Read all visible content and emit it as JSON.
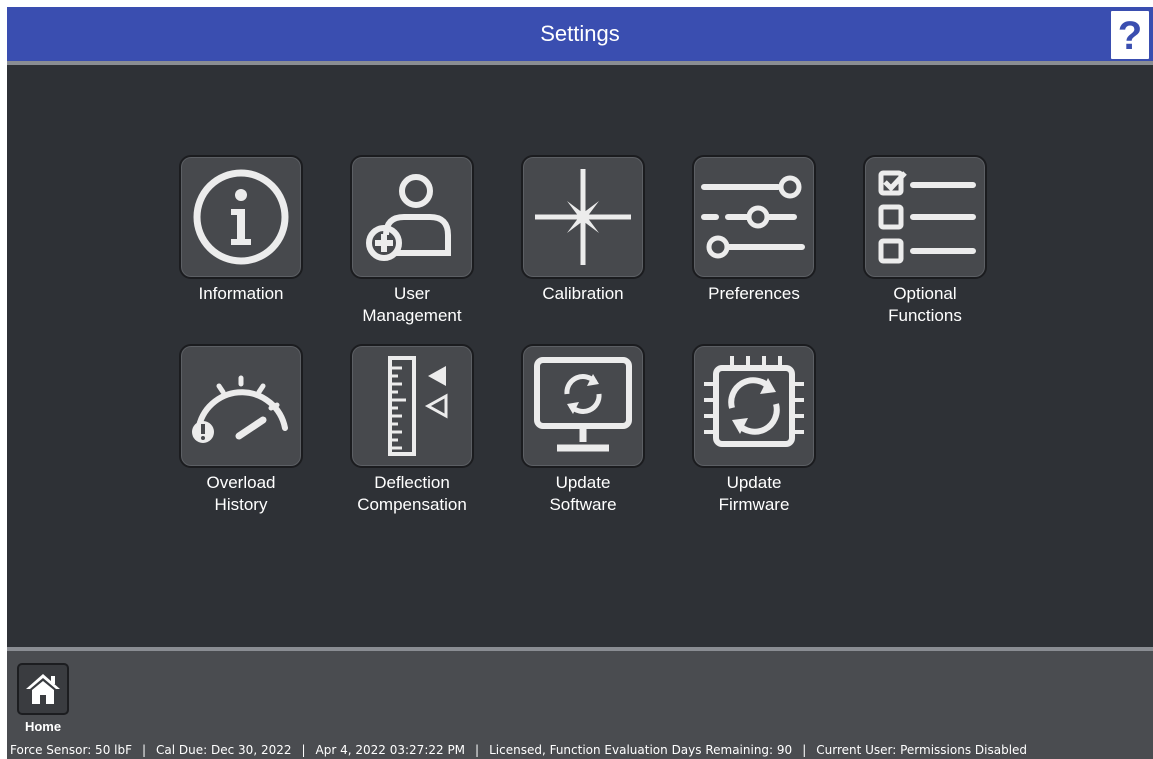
{
  "header": {
    "title": "Settings",
    "help_label": "?"
  },
  "tiles": [
    {
      "label": "Information",
      "icon": "info-icon"
    },
    {
      "label": "User\nManagement",
      "icon": "user-add-icon"
    },
    {
      "label": "Calibration",
      "icon": "crosshair-icon"
    },
    {
      "label": "Preferences",
      "icon": "sliders-icon"
    },
    {
      "label": "Optional\nFunctions",
      "icon": "checklist-icon"
    },
    {
      "label": "Overload\nHistory",
      "icon": "gauge-warning-icon"
    },
    {
      "label": "Deflection\nCompensation",
      "icon": "ruler-arrows-icon"
    },
    {
      "label": "Update\nSoftware",
      "icon": "monitor-refresh-icon"
    },
    {
      "label": "Update\nFirmware",
      "icon": "chip-refresh-icon"
    }
  ],
  "footer": {
    "home_label": "Home"
  },
  "status": {
    "force_sensor": "Force Sensor: 50 lbF",
    "cal_due": "Cal Due: Dec 30, 2022",
    "datetime": "Apr 4, 2022 03:27:22 PM",
    "license": "Licensed, Function Evaluation Days Remaining: 90",
    "current_user": "Current User: Permissions Disabled",
    "separator": "|"
  },
  "colors": {
    "header_bg": "#3a4eb0",
    "main_bg": "#2e3136",
    "tile_bg": "#47494d",
    "footer_bg": "#4a4c50"
  }
}
